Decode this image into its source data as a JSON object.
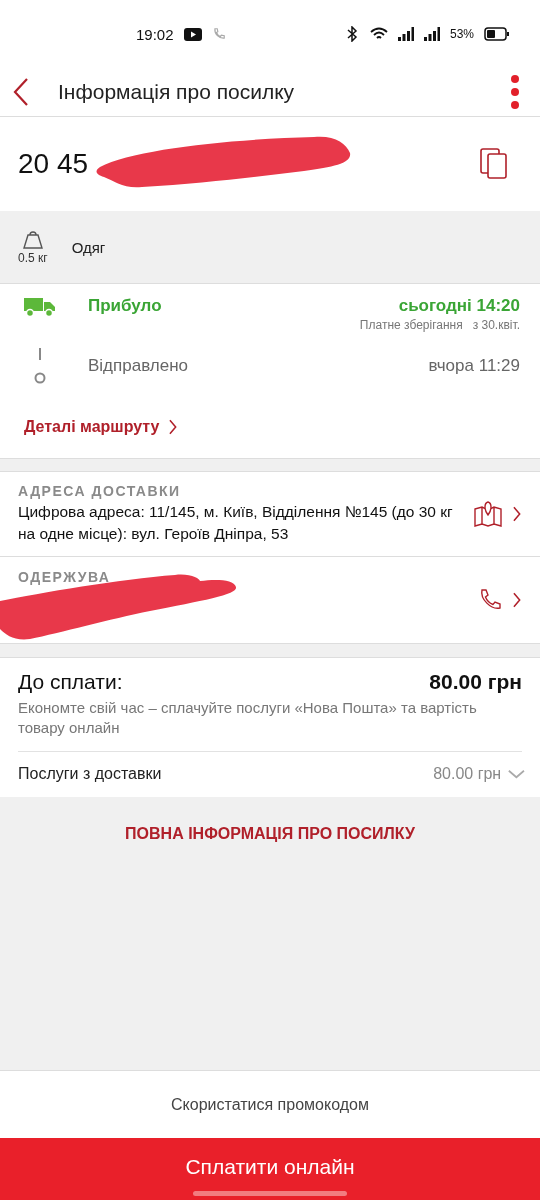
{
  "status_bar": {
    "time": "19:02",
    "battery": "53%"
  },
  "header": {
    "title": "Інформація про посилку"
  },
  "parcel": {
    "number": "20 45",
    "weight": "0.5 кг",
    "description": "Одяг"
  },
  "tracking": {
    "stages": [
      {
        "label": "Прибуло",
        "time": "сьогодні 14:20",
        "note": "Платне зберігання",
        "note_date": "з 30.квіт.",
        "active": true
      },
      {
        "label": "Відправлено",
        "time": "вчора 11:29",
        "active": false
      }
    ],
    "route_link": "Деталі маршруту"
  },
  "delivery_address": {
    "label": "АДРЕСА ДОСТАВКИ",
    "value": "Цифрова адреса: 11/145, м. Київ, Відділення №145 (до 30 кг на одне місце): вул. Героїв Дніпра, 53"
  },
  "recipient": {
    "label": "ОДЕРЖУВА"
  },
  "payment": {
    "title": "До сплати:",
    "amount": "80.00 грн",
    "hint": "Економте свій час – сплачуйте послуги «Нова Пошта» та вартість товару онлайн",
    "services": [
      {
        "label": "Послуги з доставки",
        "amount": "80.00 грн",
        "expanded": false
      }
    ]
  },
  "full_info_link": "ПОВНА ІНФОРМАЦІЯ ПРО ПОСИЛКУ",
  "promo_button": "Скористатися промокодом",
  "pay_button": "Сплатити онлайн"
}
